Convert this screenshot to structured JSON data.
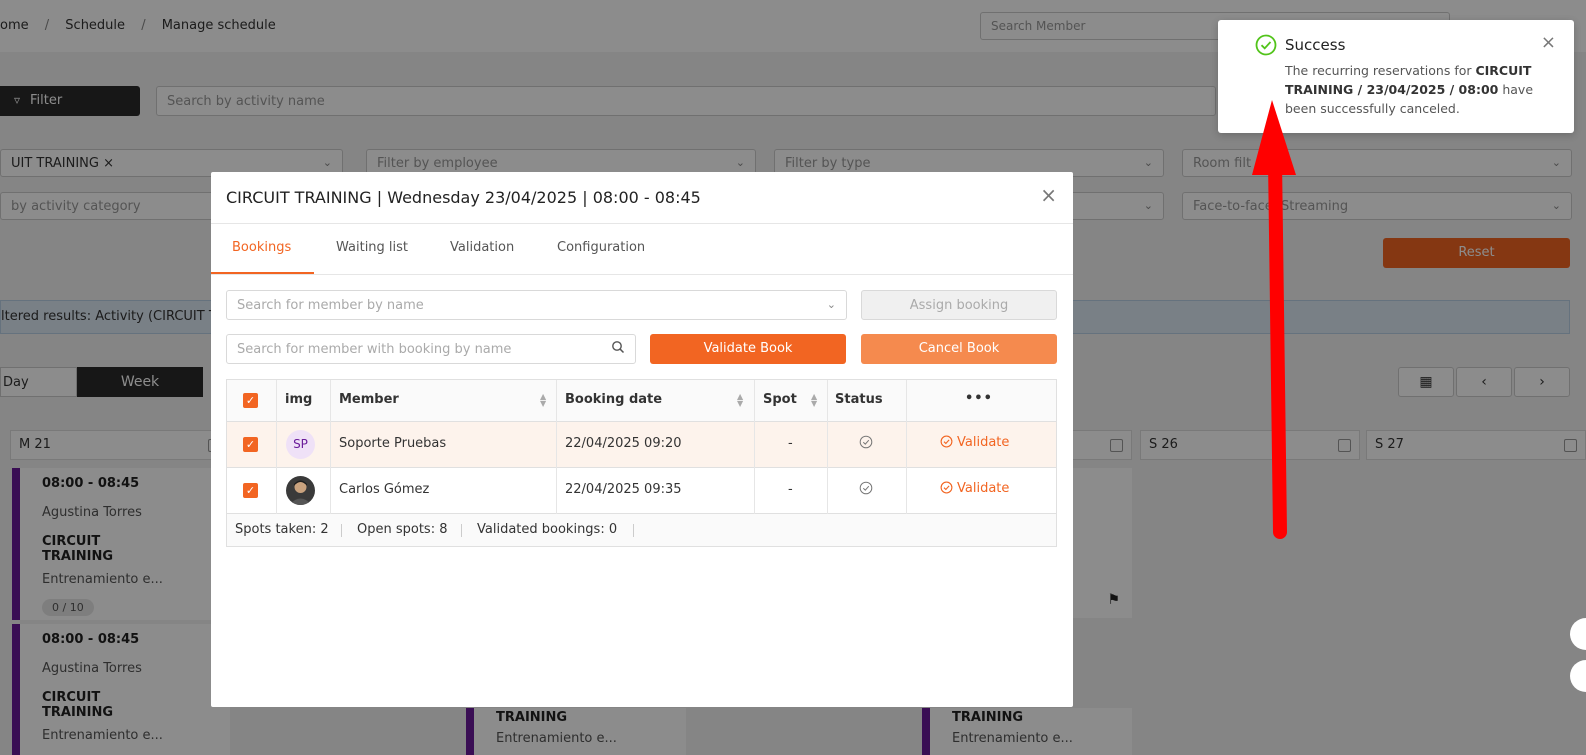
{
  "breadcrumb": {
    "home": "ome",
    "schedule": "Schedule",
    "current": "Manage schedule",
    "sep": "/"
  },
  "header": {
    "search_member_placeholder": "Search Member"
  },
  "filters": {
    "filter_label": "Filter",
    "search_activity_placeholder": "Search by activity name",
    "activity_chip": "UIT TRAINING",
    "employee_placeholder": "Filter by employee",
    "type_placeholder": "Filter by type",
    "room_placeholder": "Room filt",
    "category_placeholder": "by activity category",
    "mode_value": "Face-to-face, Streaming",
    "reset_label": "Reset"
  },
  "filtered_text": "ltered results: Activity (CIRCUIT T",
  "views": {
    "day": "Day",
    "week": "Week"
  },
  "calendar": {
    "days": [
      "M 21",
      "S 26",
      "S 27"
    ],
    "events": [
      {
        "time": "08:00 - 08:45",
        "trainer": "Agustina Torres",
        "title_line1": "CIRCUIT",
        "title_line2": "TRAINING",
        "desc": "Entrenamiento e...",
        "capacity": "0 / 10"
      },
      {
        "time": "08:00 - 08:45",
        "trainer": "Agustina Torres",
        "title_line1": "CIRCUIT",
        "title_line2": "TRAINING",
        "desc": "Entrenamiento e..."
      }
    ],
    "partial_title": "TRAINING",
    "partial_desc": "Entrenamiento e..."
  },
  "modal": {
    "title": "CIRCUIT TRAINING | Wednesday 23/04/2025 | 08:00 - 08:45",
    "tabs": [
      "Bookings",
      "Waiting list",
      "Validation",
      "Configuration"
    ],
    "active_tab": 0,
    "search_member_placeholder": "Search for member by name",
    "assign_label": "Assign booking",
    "search_booking_placeholder": "Search for member with booking by name",
    "validate_book_label": "Validate Book",
    "cancel_book_label": "Cancel Book",
    "table": {
      "columns": [
        "img",
        "Member",
        "Booking date",
        "Spot",
        "Status",
        "•••"
      ],
      "rows": [
        {
          "initials": "SP",
          "member": "Soporte Pruebas",
          "booking_date": "22/04/2025 09:20",
          "spot": "-",
          "action": "Validate"
        },
        {
          "initials": "",
          "member": "Carlos Gómez",
          "booking_date": "22/04/2025 09:35",
          "spot": "-",
          "action": "Validate"
        }
      ],
      "footer": {
        "spots_taken": "Spots taken: 2",
        "open_spots": "Open spots: 8",
        "validated": "Validated bookings: 0"
      }
    }
  },
  "toast": {
    "title": "Success",
    "msg_prefix": "The recurring reservations for ",
    "msg_bold": "CIRCUIT TRAINING / 23/04/2025 / 08:00",
    "msg_suffix": " have been successfully canceled."
  },
  "colors": {
    "accent": "#f26522",
    "success": "#52c41a",
    "annotation_arrow": "#ff0000",
    "event_bar": "#6a1b9a"
  }
}
